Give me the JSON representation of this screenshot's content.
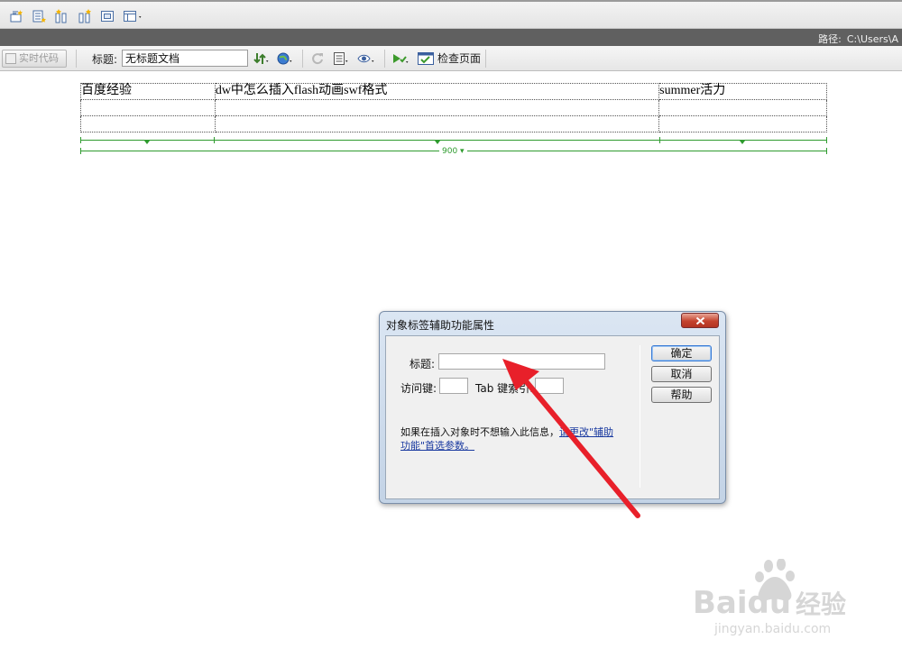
{
  "path_bar": {
    "label": "路径:",
    "value": "C:\\Users\\A"
  },
  "doc_toolbar": {
    "live_code_label": "实时代码",
    "title_label": "标题:",
    "title_value": "无标题文档",
    "check_page_label": "检查页面"
  },
  "design_table": {
    "rows": [
      [
        "百度经验",
        "dw中怎么插入flash动画swf格式",
        "summer活力"
      ],
      [
        "",
        "",
        ""
      ],
      [
        "",
        "",
        ""
      ]
    ],
    "width_label": "900"
  },
  "dialog": {
    "title": "对象标签辅助功能属性",
    "title_field_label": "标题:",
    "title_field_value": "",
    "access_key_label": "访问键:",
    "access_key_value": "",
    "tab_index_label": "Tab 键索引:",
    "tab_index_value": "",
    "note_text": "如果在插入对象时不想输入此信息，",
    "note_link": "请更改\"辅助功能\"首选参数。",
    "buttons": {
      "ok": "确定",
      "cancel": "取消",
      "help": "帮助"
    }
  },
  "watermark": {
    "brand": "Baidu",
    "cn": "经验",
    "url": "jingyan.baidu.com"
  },
  "colors": {
    "accent_green": "#2e9b2e",
    "annotation_red": "#e8202a",
    "close_red": "#c4432e"
  }
}
